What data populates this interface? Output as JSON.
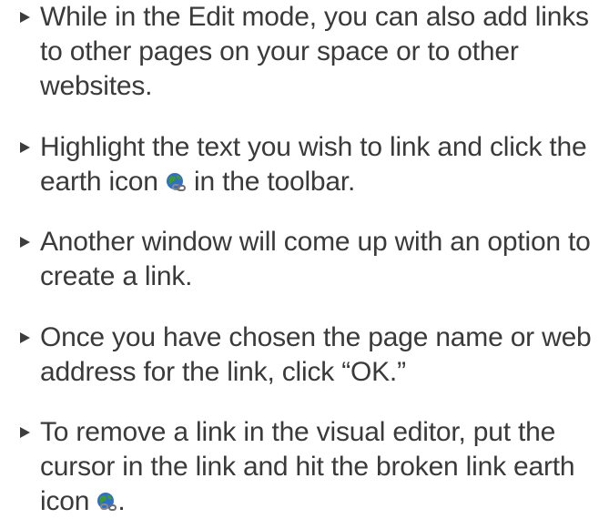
{
  "bullets": [
    {
      "text": "While in the Edit mode, you can also add links to other pages on your space or to other websites."
    },
    {
      "before": "Highlight the text you wish to link and click the earth icon",
      "icon": "earth-link-icon",
      "after": "in the toolbar."
    },
    {
      "text": "Another window will come up with an option to create a link."
    },
    {
      "text": "Once you have chosen the page name or web address for the link, click “OK.”"
    },
    {
      "before": "To remove a link in the visual editor, put the cursor in the link and hit the broken link earth icon",
      "icon": "broken-link-earth-icon",
      "after": "."
    }
  ],
  "colors": {
    "text": "#3a3a3a",
    "bullet": "#3d3d3d",
    "globe_ocean": "#2f6fc9",
    "globe_land": "#3f9a2e",
    "chain": "#8a8a8a"
  }
}
